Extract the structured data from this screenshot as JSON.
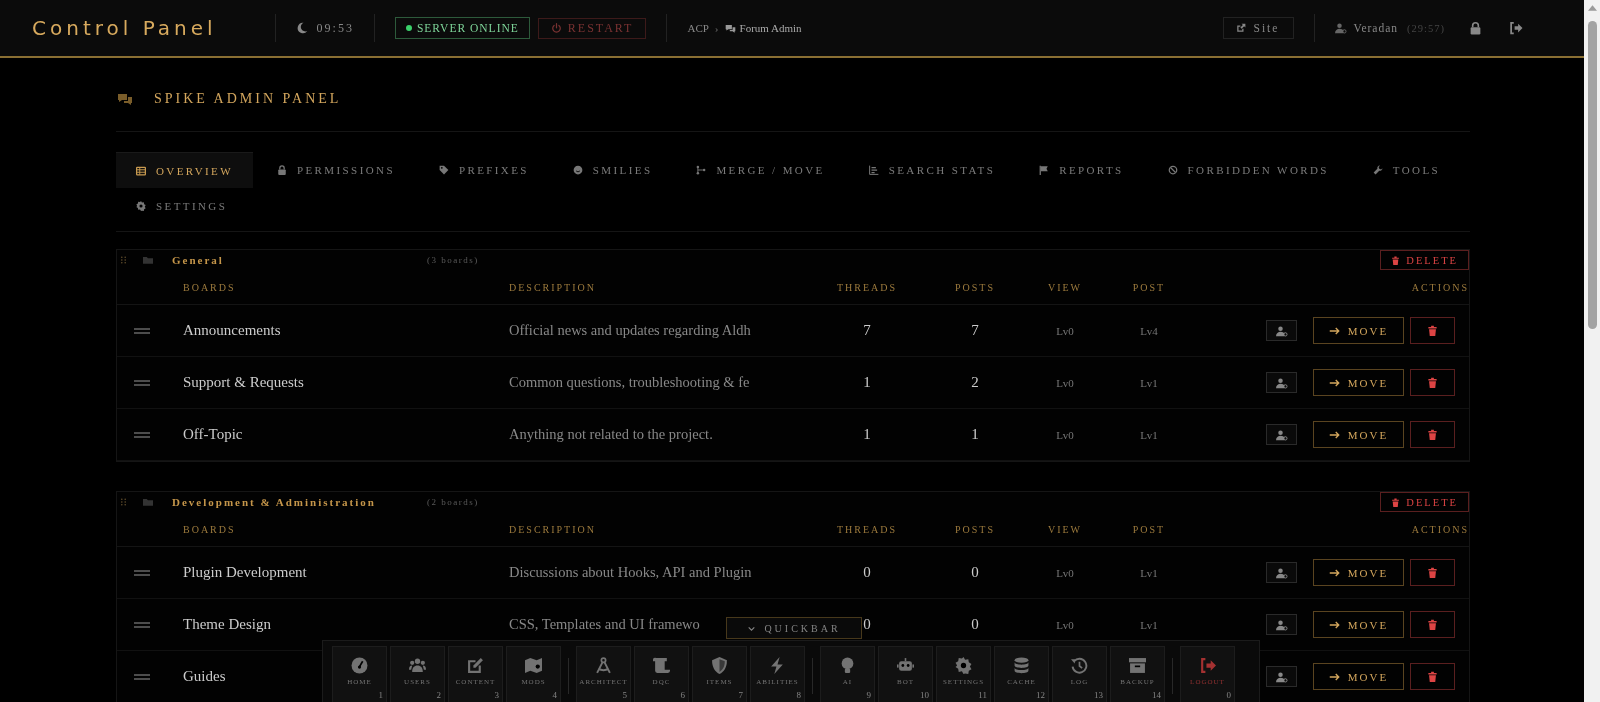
{
  "header": {
    "title": "Control Panel",
    "clock": "09:53",
    "server": {
      "label": "SERVER ONLINE",
      "online": true
    },
    "restart": "RESTART",
    "breadcrumb": [
      "ACP",
      "Forum Admin"
    ],
    "breadcrumb_separator": "›",
    "site": "Site",
    "user": "Veradan",
    "session": "(29:57)"
  },
  "panel": {
    "title": "SPIKE ADMIN PANEL"
  },
  "tabs": [
    {
      "label": "OVERVIEW",
      "selected": true
    },
    {
      "label": "PERMISSIONS",
      "selected": false
    },
    {
      "label": "PREFIXES",
      "selected": false
    },
    {
      "label": "SMILIES",
      "selected": false
    },
    {
      "label": "MERGE / MOVE",
      "selected": false
    },
    {
      "label": "SEARCH STATS",
      "selected": false
    },
    {
      "label": "REPORTS",
      "selected": false
    },
    {
      "label": "FORBIDDEN WORDS",
      "selected": false
    },
    {
      "label": "TOOLS",
      "selected": false
    },
    {
      "label": "SETTINGS",
      "selected": false
    }
  ],
  "categories": [
    {
      "name": "General",
      "count": "(3 boards)",
      "delete": "DELETE",
      "columns": [
        "BOARDS",
        "DESCRIPTION",
        "THREADS",
        "POSTS",
        "VIEW",
        "POST",
        "ACTIONS"
      ],
      "boards": [
        {
          "name": "Announcements",
          "description": "Official news and updates regarding Aldh",
          "threads": "7",
          "posts": "7",
          "view": "Lv0",
          "post": "Lv4",
          "move": "MOVE"
        },
        {
          "name": "Support & Requests",
          "description": "Common questions, troubleshooting & fe",
          "threads": "1",
          "posts": "2",
          "view": "Lv0",
          "post": "Lv1",
          "move": "MOVE"
        },
        {
          "name": "Off-Topic",
          "description": "Anything not related to the project.",
          "threads": "1",
          "posts": "1",
          "view": "Lv0",
          "post": "Lv1",
          "move": "MOVE"
        }
      ]
    },
    {
      "name": "Development & Administration",
      "count": "(2 boards)",
      "delete": "DELETE",
      "columns": [
        "BOARDS",
        "DESCRIPTION",
        "THREADS",
        "POSTS",
        "VIEW",
        "POST",
        "ACTIONS"
      ],
      "boards": [
        {
          "name": "Plugin Development",
          "description": "Discussions about Hooks, API and Plugin",
          "threads": "0",
          "posts": "0",
          "view": "Lv0",
          "post": "Lv1",
          "move": "MOVE"
        },
        {
          "name": "Theme Design",
          "description": "CSS, Templates and UI framewo",
          "threads": "0",
          "posts": "0",
          "view": "Lv0",
          "post": "Lv1",
          "move": "MOVE"
        },
        {
          "name": "Guides",
          "move": "MOVE"
        }
      ]
    }
  ],
  "quickbar": {
    "toggle": "QUICKBAR",
    "groups": [
      [
        {
          "label": "HOME",
          "key": "1"
        },
        {
          "label": "USERS",
          "key": "2"
        },
        {
          "label": "CONTENT",
          "key": "3"
        },
        {
          "label": "MODS",
          "key": "4"
        }
      ],
      [
        {
          "label": "ARCHITECT",
          "key": "5"
        },
        {
          "label": "DQC",
          "key": "6"
        },
        {
          "label": "ITEMS",
          "key": "7"
        },
        {
          "label": "ABILITIES",
          "key": "8"
        }
      ],
      [
        {
          "label": "AI",
          "key": "9"
        },
        {
          "label": "BOT",
          "key": "10"
        },
        {
          "label": "SETTINGS",
          "key": "11"
        },
        {
          "label": "CACHE",
          "key": "12"
        },
        {
          "label": "LOG",
          "key": "13"
        },
        {
          "label": "BACKUP",
          "key": "14"
        }
      ],
      [
        {
          "label": "LOGOUT",
          "key": "0",
          "danger": true
        }
      ]
    ]
  }
}
